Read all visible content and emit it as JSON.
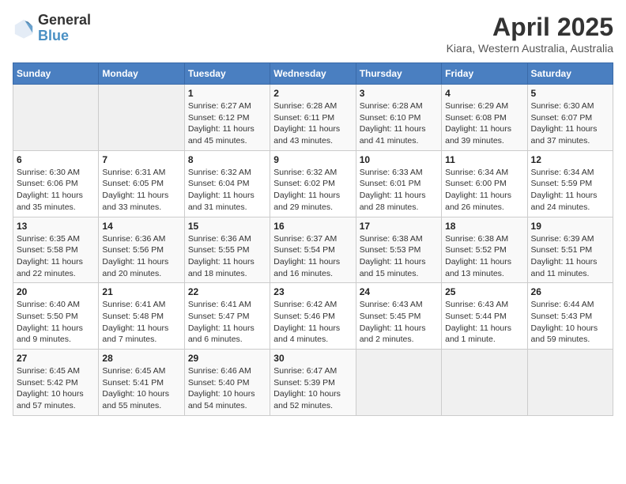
{
  "header": {
    "logo_general": "General",
    "logo_blue": "Blue",
    "title": "April 2025",
    "subtitle": "Kiara, Western Australia, Australia"
  },
  "days_of_week": [
    "Sunday",
    "Monday",
    "Tuesday",
    "Wednesday",
    "Thursday",
    "Friday",
    "Saturday"
  ],
  "weeks": [
    [
      {
        "day": "",
        "empty": true
      },
      {
        "day": "",
        "empty": true
      },
      {
        "day": "1",
        "sunrise": "Sunrise: 6:27 AM",
        "sunset": "Sunset: 6:12 PM",
        "daylight": "Daylight: 11 hours and 45 minutes."
      },
      {
        "day": "2",
        "sunrise": "Sunrise: 6:28 AM",
        "sunset": "Sunset: 6:11 PM",
        "daylight": "Daylight: 11 hours and 43 minutes."
      },
      {
        "day": "3",
        "sunrise": "Sunrise: 6:28 AM",
        "sunset": "Sunset: 6:10 PM",
        "daylight": "Daylight: 11 hours and 41 minutes."
      },
      {
        "day": "4",
        "sunrise": "Sunrise: 6:29 AM",
        "sunset": "Sunset: 6:08 PM",
        "daylight": "Daylight: 11 hours and 39 minutes."
      },
      {
        "day": "5",
        "sunrise": "Sunrise: 6:30 AM",
        "sunset": "Sunset: 6:07 PM",
        "daylight": "Daylight: 11 hours and 37 minutes."
      }
    ],
    [
      {
        "day": "6",
        "sunrise": "Sunrise: 6:30 AM",
        "sunset": "Sunset: 6:06 PM",
        "daylight": "Daylight: 11 hours and 35 minutes."
      },
      {
        "day": "7",
        "sunrise": "Sunrise: 6:31 AM",
        "sunset": "Sunset: 6:05 PM",
        "daylight": "Daylight: 11 hours and 33 minutes."
      },
      {
        "day": "8",
        "sunrise": "Sunrise: 6:32 AM",
        "sunset": "Sunset: 6:04 PM",
        "daylight": "Daylight: 11 hours and 31 minutes."
      },
      {
        "day": "9",
        "sunrise": "Sunrise: 6:32 AM",
        "sunset": "Sunset: 6:02 PM",
        "daylight": "Daylight: 11 hours and 29 minutes."
      },
      {
        "day": "10",
        "sunrise": "Sunrise: 6:33 AM",
        "sunset": "Sunset: 6:01 PM",
        "daylight": "Daylight: 11 hours and 28 minutes."
      },
      {
        "day": "11",
        "sunrise": "Sunrise: 6:34 AM",
        "sunset": "Sunset: 6:00 PM",
        "daylight": "Daylight: 11 hours and 26 minutes."
      },
      {
        "day": "12",
        "sunrise": "Sunrise: 6:34 AM",
        "sunset": "Sunset: 5:59 PM",
        "daylight": "Daylight: 11 hours and 24 minutes."
      }
    ],
    [
      {
        "day": "13",
        "sunrise": "Sunrise: 6:35 AM",
        "sunset": "Sunset: 5:58 PM",
        "daylight": "Daylight: 11 hours and 22 minutes."
      },
      {
        "day": "14",
        "sunrise": "Sunrise: 6:36 AM",
        "sunset": "Sunset: 5:56 PM",
        "daylight": "Daylight: 11 hours and 20 minutes."
      },
      {
        "day": "15",
        "sunrise": "Sunrise: 6:36 AM",
        "sunset": "Sunset: 5:55 PM",
        "daylight": "Daylight: 11 hours and 18 minutes."
      },
      {
        "day": "16",
        "sunrise": "Sunrise: 6:37 AM",
        "sunset": "Sunset: 5:54 PM",
        "daylight": "Daylight: 11 hours and 16 minutes."
      },
      {
        "day": "17",
        "sunrise": "Sunrise: 6:38 AM",
        "sunset": "Sunset: 5:53 PM",
        "daylight": "Daylight: 11 hours and 15 minutes."
      },
      {
        "day": "18",
        "sunrise": "Sunrise: 6:38 AM",
        "sunset": "Sunset: 5:52 PM",
        "daylight": "Daylight: 11 hours and 13 minutes."
      },
      {
        "day": "19",
        "sunrise": "Sunrise: 6:39 AM",
        "sunset": "Sunset: 5:51 PM",
        "daylight": "Daylight: 11 hours and 11 minutes."
      }
    ],
    [
      {
        "day": "20",
        "sunrise": "Sunrise: 6:40 AM",
        "sunset": "Sunset: 5:50 PM",
        "daylight": "Daylight: 11 hours and 9 minutes."
      },
      {
        "day": "21",
        "sunrise": "Sunrise: 6:41 AM",
        "sunset": "Sunset: 5:48 PM",
        "daylight": "Daylight: 11 hours and 7 minutes."
      },
      {
        "day": "22",
        "sunrise": "Sunrise: 6:41 AM",
        "sunset": "Sunset: 5:47 PM",
        "daylight": "Daylight: 11 hours and 6 minutes."
      },
      {
        "day": "23",
        "sunrise": "Sunrise: 6:42 AM",
        "sunset": "Sunset: 5:46 PM",
        "daylight": "Daylight: 11 hours and 4 minutes."
      },
      {
        "day": "24",
        "sunrise": "Sunrise: 6:43 AM",
        "sunset": "Sunset: 5:45 PM",
        "daylight": "Daylight: 11 hours and 2 minutes."
      },
      {
        "day": "25",
        "sunrise": "Sunrise: 6:43 AM",
        "sunset": "Sunset: 5:44 PM",
        "daylight": "Daylight: 11 hours and 1 minute."
      },
      {
        "day": "26",
        "sunrise": "Sunrise: 6:44 AM",
        "sunset": "Sunset: 5:43 PM",
        "daylight": "Daylight: 10 hours and 59 minutes."
      }
    ],
    [
      {
        "day": "27",
        "sunrise": "Sunrise: 6:45 AM",
        "sunset": "Sunset: 5:42 PM",
        "daylight": "Daylight: 10 hours and 57 minutes."
      },
      {
        "day": "28",
        "sunrise": "Sunrise: 6:45 AM",
        "sunset": "Sunset: 5:41 PM",
        "daylight": "Daylight: 10 hours and 55 minutes."
      },
      {
        "day": "29",
        "sunrise": "Sunrise: 6:46 AM",
        "sunset": "Sunset: 5:40 PM",
        "daylight": "Daylight: 10 hours and 54 minutes."
      },
      {
        "day": "30",
        "sunrise": "Sunrise: 6:47 AM",
        "sunset": "Sunset: 5:39 PM",
        "daylight": "Daylight: 10 hours and 52 minutes."
      },
      {
        "day": "",
        "empty": true
      },
      {
        "day": "",
        "empty": true
      },
      {
        "day": "",
        "empty": true
      }
    ]
  ]
}
